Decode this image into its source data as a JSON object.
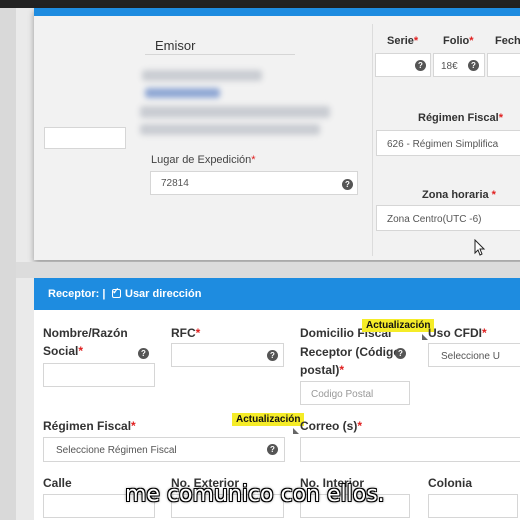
{
  "emisor": {
    "title": "Emisor",
    "lugar_label": "Lugar de Expedición",
    "lugar_value": "72814",
    "required_mark": "*"
  },
  "header_cols": {
    "serie_label": "Serie",
    "folio_label": "Folio",
    "fecha_label": "Fech",
    "folio_value": "18€"
  },
  "regimen_emisor": {
    "label": "Régimen Fiscal",
    "value": "626 - Régimen Simplifica"
  },
  "zona": {
    "label": "Zona horaria",
    "value": "Zona Centro(UTC -6)"
  },
  "receptor": {
    "header_label": "Receptor: |",
    "usar_direccion": "Usar dirección",
    "nombre_label_1": "Nombre/Razón",
    "nombre_label_2": "Social",
    "rfc_label": "RFC",
    "domicilio_label_1": "Domicilio Fiscal",
    "domicilio_label_2": "Receptor (Código",
    "domicilio_label_3": "postal)",
    "codigo_placeholder": "Codigo Postal",
    "uso_label": "Uso CFDI",
    "uso_value": "Seleccione U",
    "regimen_label": "Régimen Fiscal",
    "regimen_value": "Seleccione Régimen Fiscal",
    "correo_label": "Correo (s)",
    "calle_label": "Calle",
    "no_ext_label": "No. Exterior",
    "no_int_label": "No. Interior",
    "colonia_label": "Colonia"
  },
  "annotations": {
    "tag1": "Actualización",
    "tag2": "Actualización"
  },
  "subtitle": "me comunico con ellos.",
  "icons": [
    "question-icon",
    "checkbox-icon",
    "mouse-cursor-icon"
  ]
}
